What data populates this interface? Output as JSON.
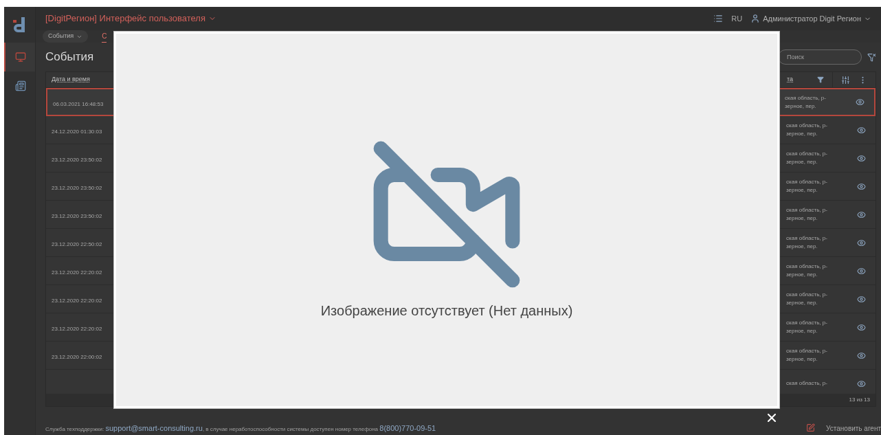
{
  "app": {
    "title": "[DigitРегион] Интерфейс пользователя",
    "language": "RU",
    "user": "Администратор Digit Регион"
  },
  "sidebar": {
    "items": [
      {
        "kind": "monitor",
        "selected": true
      },
      {
        "kind": "list",
        "selected": false
      }
    ]
  },
  "tabs": [
    {
      "label": "События",
      "kind": "dropdown",
      "selected": false
    },
    {
      "label": "С",
      "kind": "tab",
      "selected": true
    }
  ],
  "page": {
    "heading": "События",
    "search": {
      "placeholder": "Поиск"
    }
  },
  "table": {
    "columns": [
      "Дата и время",
      "та"
    ],
    "rows": [
      {
        "date": "06.03.2021 16:48:53",
        "address": "ская область, р-\nзерное, пер.",
        "selected": true
      },
      {
        "date": "24.12.2020 01:30:03",
        "address": "ская область, р-\nзерное, пер.",
        "selected": false
      },
      {
        "date": "23.12.2020 23:50:02",
        "address": "ская область, р-\nзерное, пер.",
        "selected": false
      },
      {
        "date": "23.12.2020 23:50:02",
        "address": "ская область, р-\nзерное, пер.",
        "selected": false
      },
      {
        "date": "23.12.2020 23:50:02",
        "address": "ская область, р-\nзерное, пер.",
        "selected": false
      },
      {
        "date": "23.12.2020 22:50:02",
        "address": "ская область, р-\nзерное, пер.",
        "selected": false
      },
      {
        "date": "23.12.2020 22:20:02",
        "address": "ская область, р-\nзерное, пер.",
        "selected": false
      },
      {
        "date": "23.12.2020 22:20:02",
        "address": "ская область, р-\nзерное, пер.",
        "selected": false
      },
      {
        "date": "23.12.2020 22:20:02",
        "address": "ская область, р-\nзерное, пер.",
        "selected": false
      },
      {
        "date": "23.12.2020 22:00:02",
        "address": "ская область, р-\nзерное, пер.",
        "selected": false
      },
      {
        "address": "ская область, р-",
        "selected": false
      }
    ],
    "footer": "13 из 13"
  },
  "support": {
    "text1": "Служба техподдержки:",
    "email": "support@smart-consulting.ru",
    "text2": ", в случае неработоспособности системы доступен номер телефона",
    "phone": "8(800)770-09-51"
  },
  "agent_button": "Установить агент",
  "modal": {
    "message": "Изображение отсутствует (Нет данных)"
  }
}
